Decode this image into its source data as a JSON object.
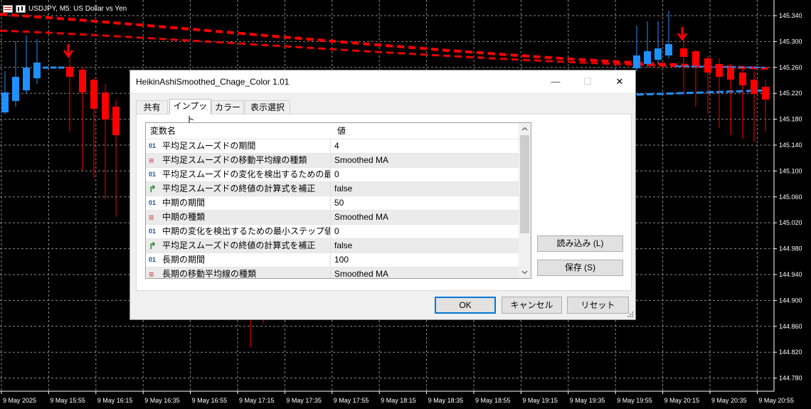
{
  "chart": {
    "symbol_title": "USDJPY, M5:  US Dollar vs Yen",
    "price_labels": [
      "145.340",
      "145.300",
      "145.260",
      "145.220",
      "145.180",
      "145.140",
      "145.100",
      "145.060",
      "145.020",
      "144.980",
      "144.940",
      "144.900",
      "144.860",
      "144.820",
      "144.780"
    ],
    "time_labels": [
      "9 May 2025",
      "9 May 15:55",
      "9 May 16:15",
      "9 May 16:35",
      "9 May 16:55",
      "9 May 17:15",
      "9 May 17:35",
      "9 May 17:55",
      "9 May 18:15",
      "9 May 18:35",
      "9 May 18:55",
      "9 May 19:15",
      "9 May 19:35",
      "9 May 19:55",
      "9 May 20:15",
      "9 May 20:35",
      "9 May 20:55"
    ],
    "colors": {
      "bull": "#1e90ff",
      "bear": "#ff0000",
      "grid": "#8a8a8a",
      "background": "#000000"
    }
  },
  "dialog": {
    "title": "HeikinAshiSmoothed_Chage_Color 1.01",
    "tabs": [
      {
        "label": "共有"
      },
      {
        "label": "インプット"
      },
      {
        "label": "カラー"
      },
      {
        "label": "表示選択"
      }
    ],
    "columns": {
      "name": "変数名",
      "value": "値"
    },
    "rows": [
      {
        "icon": "01",
        "icon_name": "int-icon",
        "name": "平均足スムーズドの期間",
        "value": "4"
      },
      {
        "icon": "≡",
        "icon_name": "enum-icon",
        "name": "平均足スムーズドの移動平均線の種類",
        "value": "Smoothed MA"
      },
      {
        "icon": "01",
        "icon_name": "int-icon",
        "name": "平均足スムーズドの変化を検出するための最小ス...",
        "value": "0"
      },
      {
        "icon": "↱",
        "icon_name": "bool-icon",
        "name": "平均足スムーズドの終値の計算式を補正",
        "value": "false"
      },
      {
        "icon": "01",
        "icon_name": "int-icon",
        "name": "中期の期間",
        "value": "50"
      },
      {
        "icon": "≡",
        "icon_name": "enum-icon",
        "name": "中期の種類",
        "value": "Smoothed MA"
      },
      {
        "icon": "01",
        "icon_name": "int-icon",
        "name": "中期の変化を検出するための最小ステップ値",
        "value": "0"
      },
      {
        "icon": "↱",
        "icon_name": "bool-icon",
        "name": "平均足スムーズドの終値の計算式を補正",
        "value": "false"
      },
      {
        "icon": "01",
        "icon_name": "int-icon",
        "name": "長期の期間",
        "value": "100"
      },
      {
        "icon": "≡",
        "icon_name": "enum-icon",
        "name": "長期の移動平均線の種類",
        "value": "Smoothed MA"
      }
    ],
    "buttons": {
      "load": "読み込み (L)",
      "save": "保存 (S)",
      "ok": "OK",
      "cancel": "キャンセル",
      "reset": "リセット"
    },
    "window_buttons": {
      "minimize": "—",
      "maximize": "☐",
      "close": "✕"
    }
  }
}
